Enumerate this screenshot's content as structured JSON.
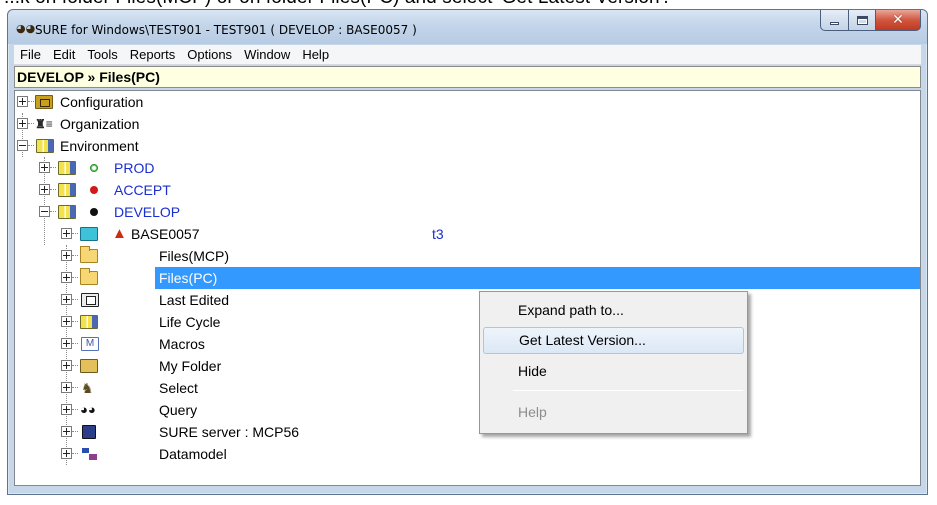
{
  "caption": "...k on folder Files(MCP) or on folder Files(PC) and select 'Get Latest Version'.",
  "window": {
    "title": "SURE for Windows\\TEST901 - TEST901 ( DEVELOP : BASE0057 )",
    "minimize_glyph": "",
    "close_glyph": "✕"
  },
  "menubar": {
    "items": [
      "File",
      "Edit",
      "Tools",
      "Reports",
      "Options",
      "Window",
      "Help"
    ]
  },
  "pathbar": {
    "text": "DEVELOP » Files(PC)"
  },
  "tree": {
    "items": [
      {
        "label": "Configuration",
        "icon": "configuration-icon"
      },
      {
        "label": "Organization",
        "icon": "organization-icon"
      },
      {
        "label": "Environment",
        "icon": "environment-icon"
      },
      {
        "label": "PROD",
        "icon": "environment-icon",
        "status": "green"
      },
      {
        "label": "ACCEPT",
        "icon": "environment-icon",
        "status": "red"
      },
      {
        "label": "DEVELOP",
        "icon": "environment-icon",
        "status": "black"
      },
      {
        "label": "BASE0057",
        "icon": "base-icon",
        "tag": "t3"
      },
      {
        "label": "Files(MCP)",
        "icon": "folder-icon"
      },
      {
        "label": "Files(PC)",
        "icon": "folder-icon",
        "selected": true
      },
      {
        "label": "Last Edited",
        "icon": "last-edited-icon"
      },
      {
        "label": "Life Cycle",
        "icon": "environment-icon"
      },
      {
        "label": "Macros",
        "icon": "macros-icon"
      },
      {
        "label": "My Folder",
        "icon": "my-folder-icon"
      },
      {
        "label": "Select",
        "icon": "select-icon"
      },
      {
        "label": "Query",
        "icon": "query-icon"
      },
      {
        "label": "SURE server : MCP56",
        "icon": "server-icon"
      },
      {
        "label": "Datamodel",
        "icon": "datamodel-icon"
      }
    ]
  },
  "context_menu": {
    "items": [
      {
        "label": "Expand path to...",
        "state": "normal"
      },
      {
        "label": "Get Latest Version...",
        "state": "hover"
      },
      {
        "label": "Hide",
        "state": "normal"
      },
      {
        "label": "Help",
        "state": "disabled"
      }
    ]
  },
  "colors": {
    "selection": "#3399ff",
    "link_text": "#1a2fcf",
    "pathbar_bg": "#ffffe1",
    "menu_bg": "#f0f0f0"
  }
}
